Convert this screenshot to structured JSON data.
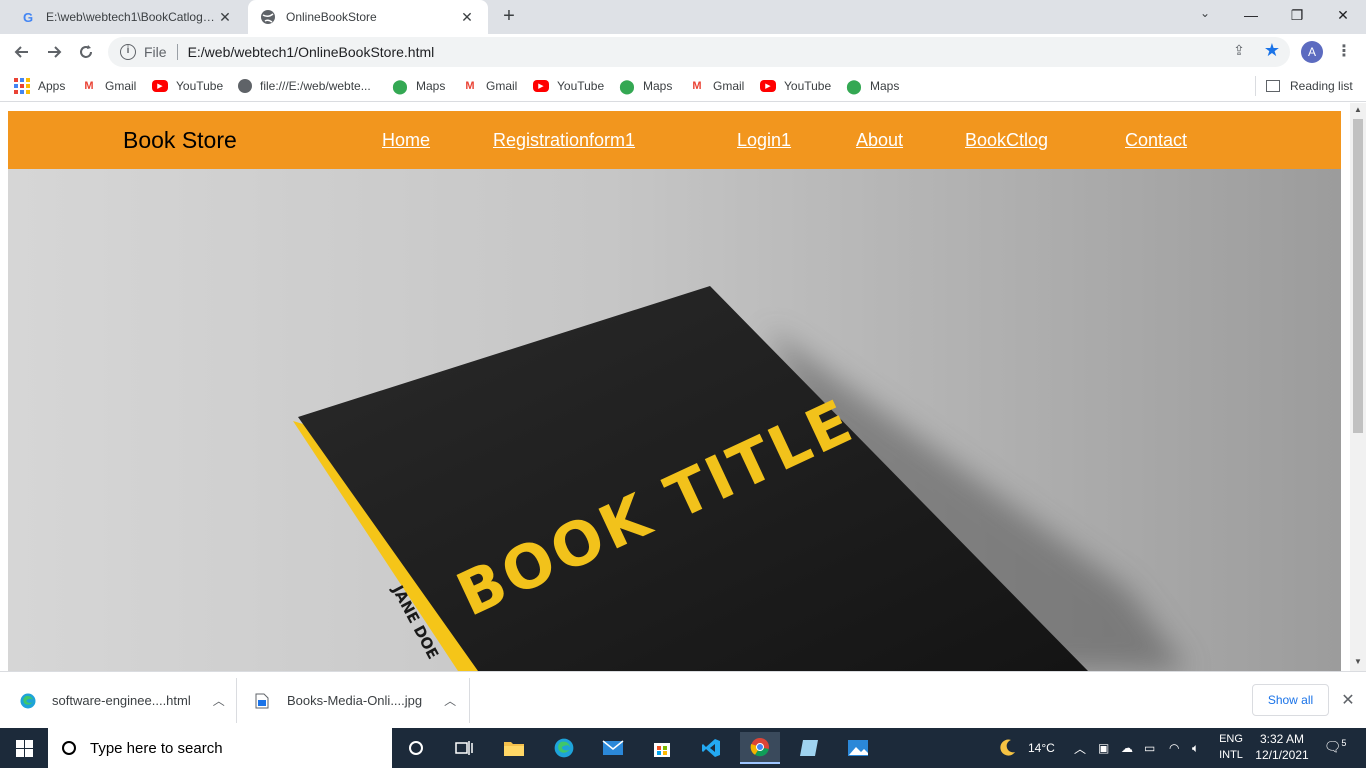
{
  "browser": {
    "tabs": [
      {
        "title": "E:\\web\\webtech1\\BookCatlog.htm",
        "favicon": "google-g-icon",
        "active": false
      },
      {
        "title": "OnlineBookStore",
        "favicon": "globe-icon",
        "active": true
      }
    ],
    "new_tab_symbol": "+",
    "window_controls": {
      "minimize": "—",
      "restore": "❐",
      "close": "✕"
    },
    "address_bar": {
      "chip": "File",
      "url": "E:/web/webtech1/OnlineBookStore.html"
    },
    "profile_initial": "A",
    "bookmarks": [
      {
        "label": "Apps",
        "icon": "apps-grid-icon"
      },
      {
        "label": "Gmail",
        "icon": "gmail-icon"
      },
      {
        "label": "YouTube",
        "icon": "youtube-icon"
      },
      {
        "label": "file:///E:/web/webte...",
        "icon": "globe-icon"
      },
      {
        "label": "Maps",
        "icon": "maps-icon"
      },
      {
        "label": "Gmail",
        "icon": "gmail-icon"
      },
      {
        "label": "YouTube",
        "icon": "youtube-icon"
      },
      {
        "label": "Maps",
        "icon": "maps-icon"
      },
      {
        "label": "Gmail",
        "icon": "gmail-icon"
      },
      {
        "label": "YouTube",
        "icon": "youtube-icon"
      },
      {
        "label": "Maps",
        "icon": "maps-icon"
      }
    ],
    "reading_list": "Reading list"
  },
  "page": {
    "brand": "Book Store",
    "nav_links": [
      "Home",
      "Registrationform1",
      "Login1",
      "About",
      "BookCtlog",
      "Contact"
    ],
    "hero": {
      "book_title": "BOOK TITLE",
      "book_author": "JANE DOE"
    },
    "colors": {
      "nav_background": "#f2961e",
      "nav_link": "#ffffff",
      "book_cover": "#1a1a1a",
      "book_accent": "#f5c518"
    }
  },
  "downloads": {
    "items": [
      {
        "name": "software-enginee....html",
        "icon": "edge-file-icon"
      },
      {
        "name": "Books-Media-Onli....jpg",
        "icon": "image-file-icon"
      }
    ],
    "show_all": "Show all"
  },
  "taskbar": {
    "search_placeholder": "Type here to search",
    "weather": "14°C",
    "language": [
      "ENG",
      "INTL"
    ],
    "time": "3:32 AM",
    "date": "12/1/2021",
    "notification_count": "5"
  }
}
